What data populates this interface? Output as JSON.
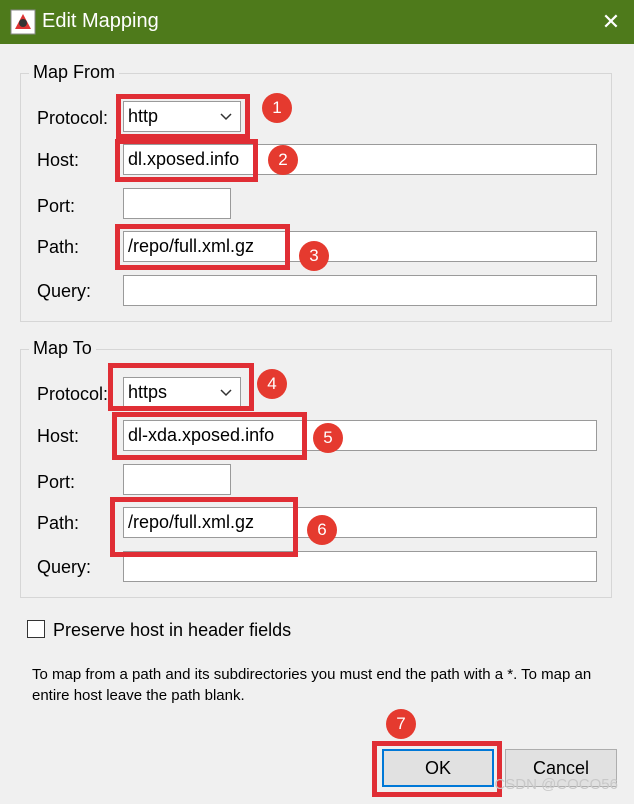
{
  "window": {
    "title": "Edit Mapping",
    "close_glyph": "✕",
    "titlebar_color": "#4e7a1b"
  },
  "map_from": {
    "legend": "Map From",
    "protocol_label": "Protocol:",
    "protocol_value": "http",
    "host_label": "Host:",
    "host_value": "dl.xposed.info",
    "port_label": "Port:",
    "port_value": "",
    "path_label": "Path:",
    "path_value": "/repo/full.xml.gz",
    "query_label": "Query:",
    "query_value": ""
  },
  "map_to": {
    "legend": "Map To",
    "protocol_label": "Protocol:",
    "protocol_value": "https",
    "host_label": "Host:",
    "host_value": "dl-xda.xposed.info",
    "port_label": "Port:",
    "port_value": "",
    "path_label": "Path:",
    "path_value": "/repo/full.xml.gz",
    "query_label": "Query:",
    "query_value": ""
  },
  "preserve_host": {
    "label": "Preserve host in header fields",
    "checked": false
  },
  "help_text": "To map from a path and its subdirectories you must end the path with a *. To map an entire host leave the path blank.",
  "buttons": {
    "ok": "OK",
    "cancel": "Cancel"
  },
  "annotations": {
    "color": "#e02e35",
    "badges": [
      "1",
      "2",
      "3",
      "4",
      "5",
      "6",
      "7"
    ]
  },
  "watermark": "CSDN @COCO56",
  "icons": {
    "app": "app-icon",
    "close": "close-icon",
    "dropdown": "chevron-down-icon"
  }
}
